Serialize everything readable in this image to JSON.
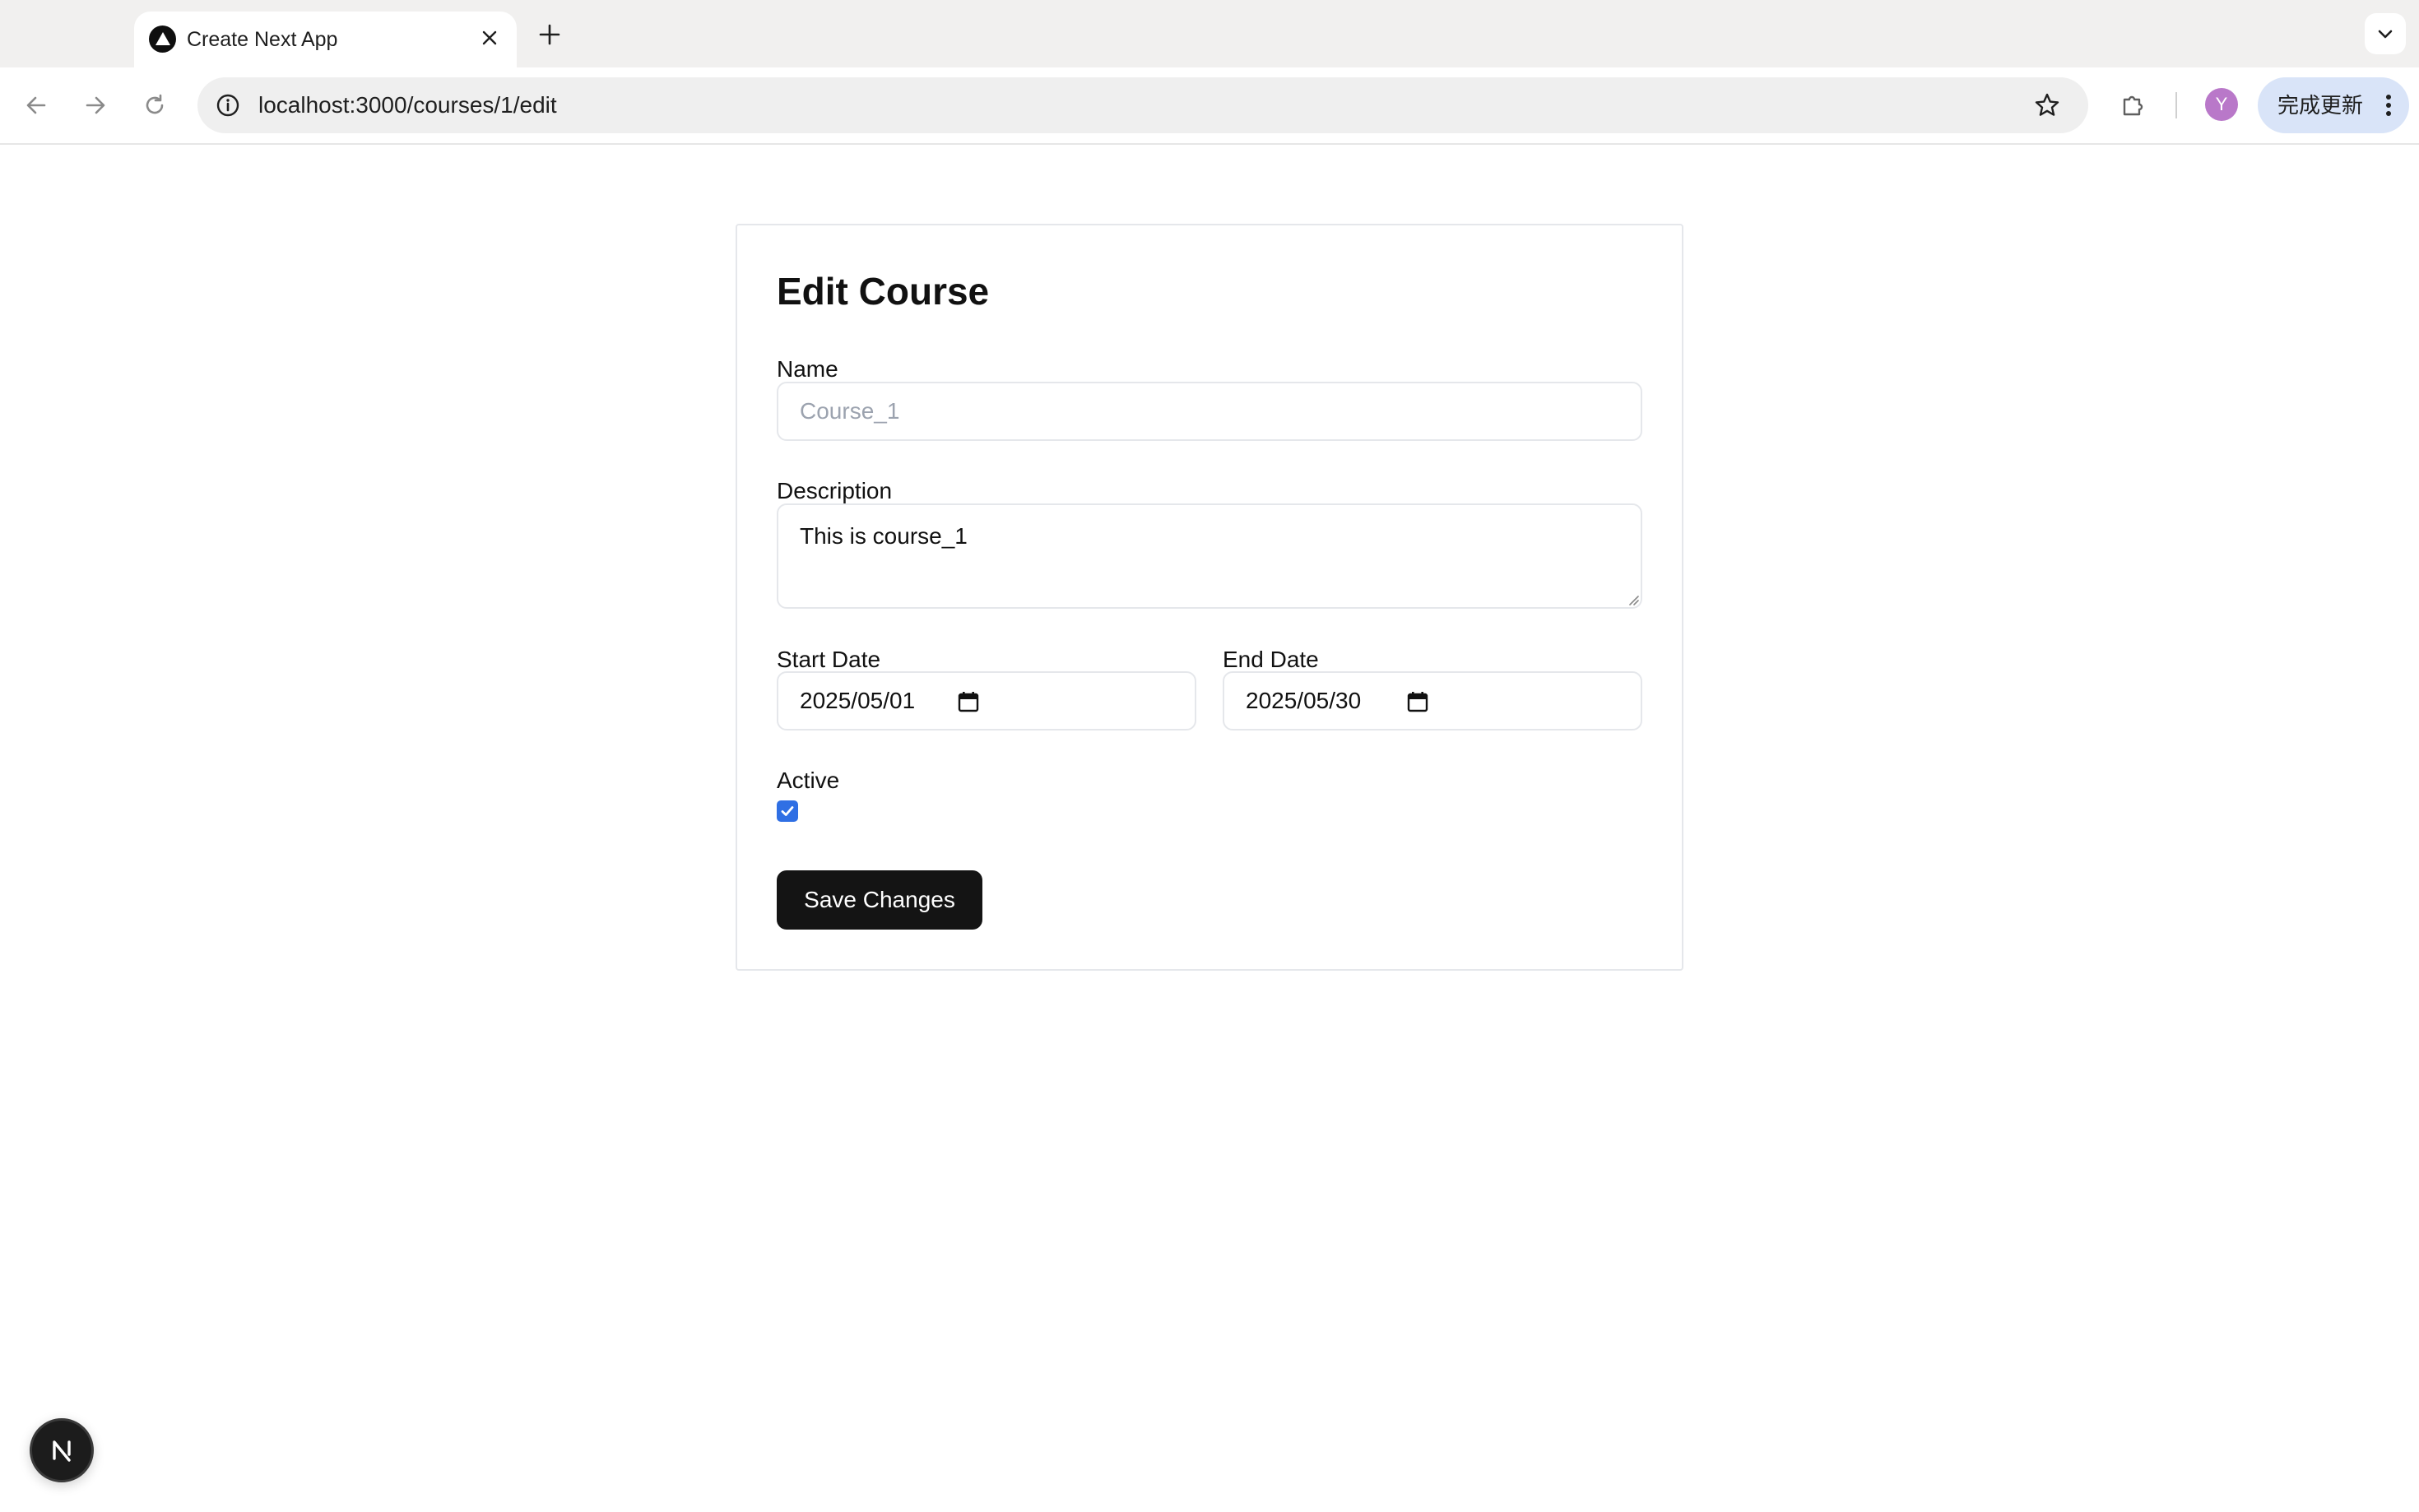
{
  "browser": {
    "tab": {
      "title": "Create Next App",
      "favicon": "nextjs-triangle-icon"
    },
    "url": "localhost:3000/courses/1/edit",
    "avatar_letter": "Y",
    "update_label": "完成更新",
    "icons": {
      "back": "arrow-left-icon",
      "forward": "arrow-right-icon",
      "reload": "reload-icon",
      "site_info": "info-icon",
      "bookmark": "star-icon",
      "extensions": "puzzle-icon",
      "menu": "kebab-menu-icon",
      "new_tab": "plus-icon",
      "tab_search": "chevron-down-icon",
      "close_tab": "close-icon"
    }
  },
  "form": {
    "title": "Edit Course",
    "name": {
      "label": "Name",
      "value": "",
      "placeholder": "Course_1"
    },
    "description": {
      "label": "Description",
      "value": "This is course_1"
    },
    "start_date": {
      "label": "Start Date",
      "value": "2025/05/01"
    },
    "end_date": {
      "label": "End Date",
      "value": "2025/05/30"
    },
    "active": {
      "label": "Active",
      "checked": true
    },
    "submit_label": "Save Changes"
  },
  "dev_badge": {
    "letter": "N",
    "icon": "nextjs-logo-icon"
  },
  "colors": {
    "checkbox_accent": "#2f6fe4",
    "button_bg": "#141414",
    "avatar_bg": "#b978c9",
    "update_pill_bg": "#d9e4f8"
  }
}
